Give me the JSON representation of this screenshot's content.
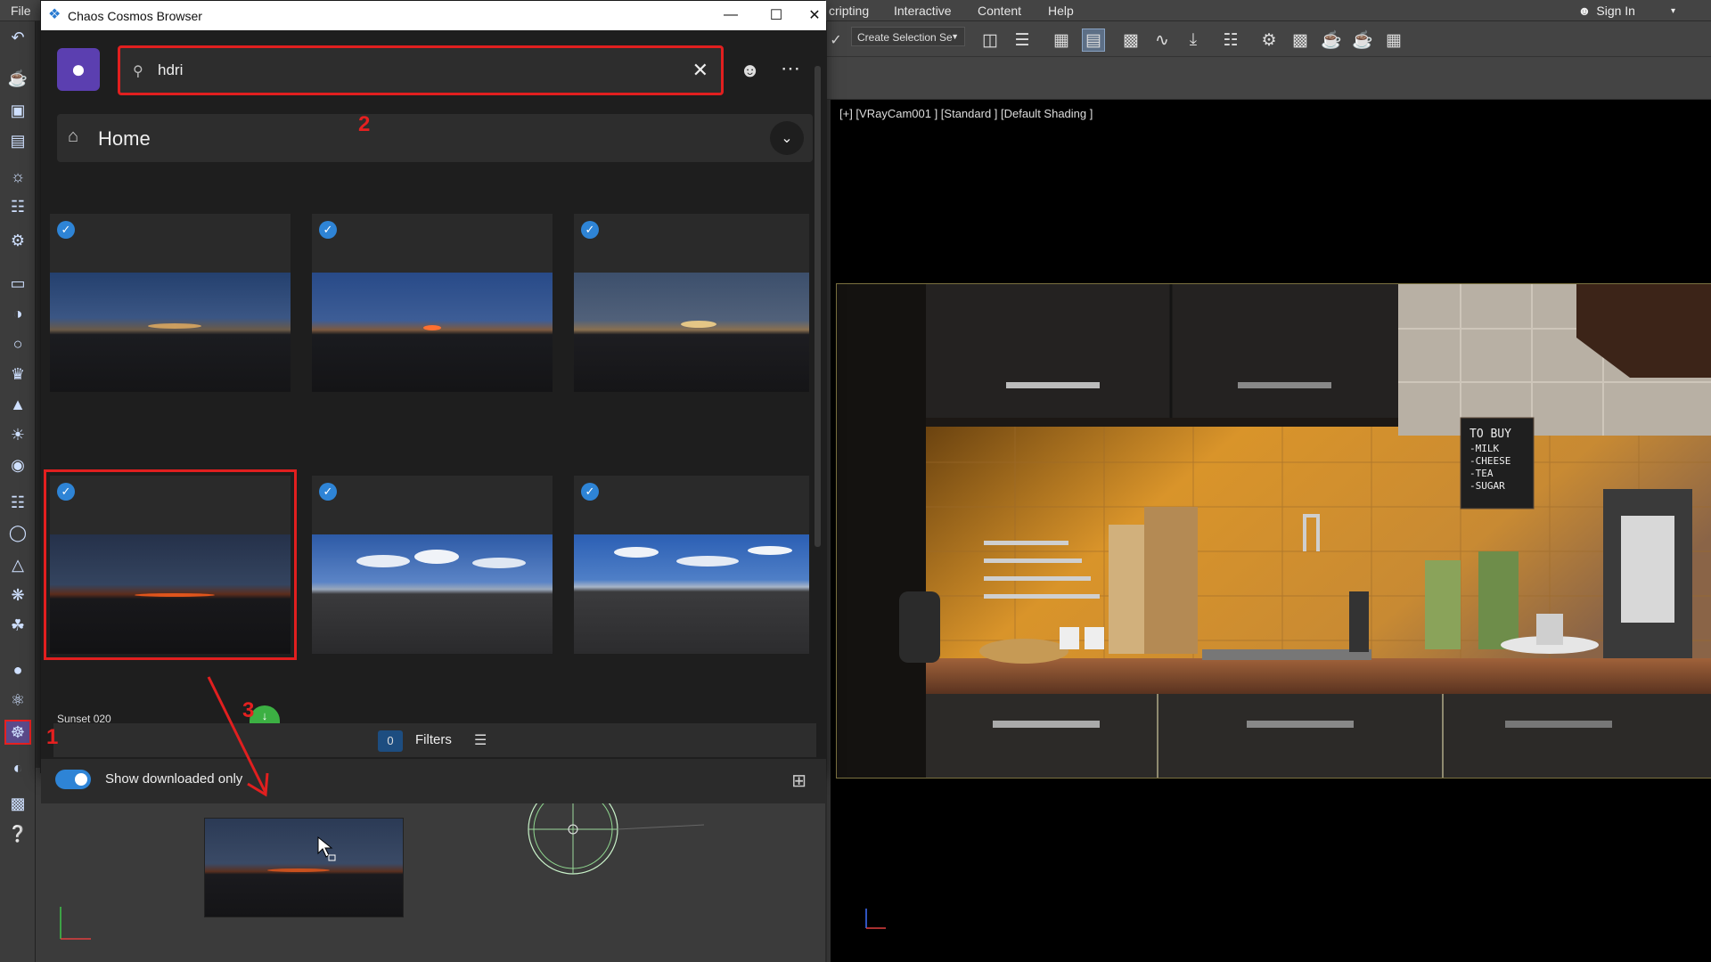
{
  "max": {
    "menu": [
      "File",
      "cripting",
      "Interactive",
      "Content",
      "Help"
    ],
    "sign_in": "Sign In",
    "selection_set": "Create Selection Se",
    "viewport_label": "[+] [VRayCam001 ] [Standard ] [Default Shading ]",
    "kitchen_sign": [
      "TO BUY",
      "-MILK",
      "-CHEESE",
      "-TEA",
      "-SUGAR"
    ]
  },
  "cosmos": {
    "title": "Chaos Cosmos Browser",
    "search_value": "hdri",
    "home_label": "Home",
    "caption": "Sunset 020",
    "filter_count": "0",
    "filters_label": "Filters",
    "show_downloaded_label": "Show downloaded only"
  },
  "annotations": [
    "1",
    "2",
    "3"
  ],
  "colors": {
    "highlight": "#e11f1f",
    "accent": "#2e84d6",
    "logo": "#5b3fb0"
  }
}
